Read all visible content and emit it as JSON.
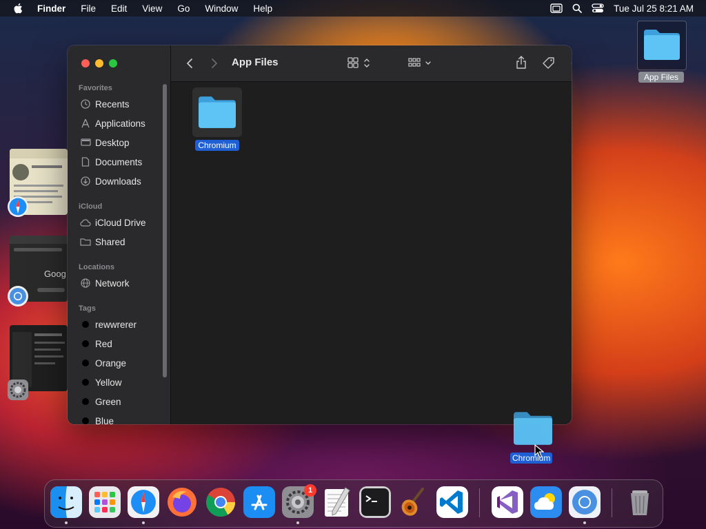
{
  "menubar": {
    "app_name": "Finder",
    "items": [
      "File",
      "Edit",
      "View",
      "Go",
      "Window",
      "Help"
    ],
    "clock": "Tue Jul 25  8:21 AM"
  },
  "desktop": {
    "folder_label": "App Files",
    "drag_item_label": "Chromium"
  },
  "finder": {
    "title": "App Files",
    "sidebar": {
      "favorites_header": "Favorites",
      "favorites": [
        "Recents",
        "Applications",
        "Desktop",
        "Documents",
        "Downloads"
      ],
      "icloud_header": "iCloud",
      "icloud": [
        "iCloud Drive",
        "Shared"
      ],
      "locations_header": "Locations",
      "locations": [
        "Network"
      ],
      "tags_header": "Tags",
      "tags": [
        "rewwrerer",
        "Red",
        "Orange",
        "Yellow",
        "Green",
        "Blue"
      ]
    },
    "items": [
      {
        "name": "Chromium",
        "selected": true
      }
    ]
  },
  "dock": {
    "apps": [
      "Finder",
      "Launchpad",
      "Safari",
      "Firefox",
      "Chrome",
      "App Store",
      "System Settings",
      "TextEdit",
      "Terminal",
      "GarageBand",
      "Visual Studio Code",
      "Visual Studio",
      "Weather",
      "Chromium",
      "Trash"
    ],
    "system_settings_badge": "1"
  },
  "colors": {
    "selection_blue": "#1f5fd6",
    "folder_blue": "#4fb8ef",
    "sidebar_bg": "#2a2a2c",
    "content_bg": "#1e1e1e"
  }
}
